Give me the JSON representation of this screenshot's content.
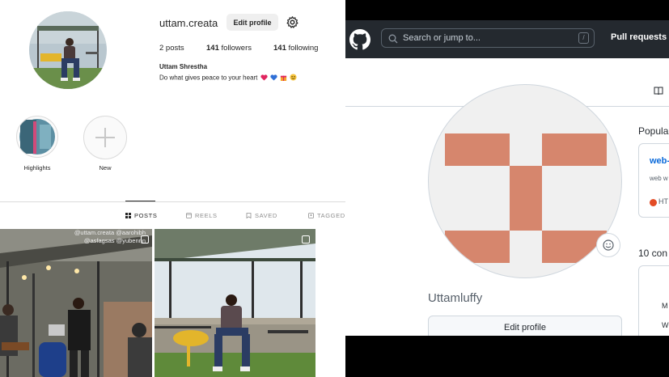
{
  "instagram": {
    "username": "uttam.creata",
    "edit_profile_label": "Edit profile",
    "settings_icon": "gear-icon",
    "stats": {
      "posts_value": "2",
      "posts_label": " posts",
      "followers_value": "141",
      "followers_label": " followers",
      "following_value": "141",
      "following_label": " following"
    },
    "full_name": "Uttam Shrestha",
    "bio": "Do what gives peace to your heart",
    "highlights": [
      {
        "label": "Highlights"
      },
      {
        "label": "New"
      }
    ],
    "tabs": [
      {
        "label": "POSTS",
        "icon": "grid-icon",
        "active": true
      },
      {
        "label": "REELS",
        "icon": "reels-icon",
        "active": false
      },
      {
        "label": "SAVED",
        "icon": "bookmark-icon",
        "active": false
      },
      {
        "label": "TAGGED",
        "icon": "tagged-icon",
        "active": false
      }
    ],
    "post_caption_line1": "@uttam.creata @aarohibh",
    "post_caption_line2": "@asfagsas @yubennn"
  },
  "github": {
    "search_placeholder": "Search or jump to...",
    "search_shortcut": "/",
    "nav_pull_requests": "Pull requests",
    "username": "Uttamluffy",
    "edit_profile_label": "Edit profile",
    "popular_heading": "Popula",
    "repo_name": "web-",
    "repo_desc": "web w",
    "repo_lang": "HT",
    "repo_lang_color": "#e34c26",
    "contrib_heading": "10 con",
    "contrib_m": "M",
    "contrib_w": "W",
    "identicon_color": "#d6866d"
  }
}
